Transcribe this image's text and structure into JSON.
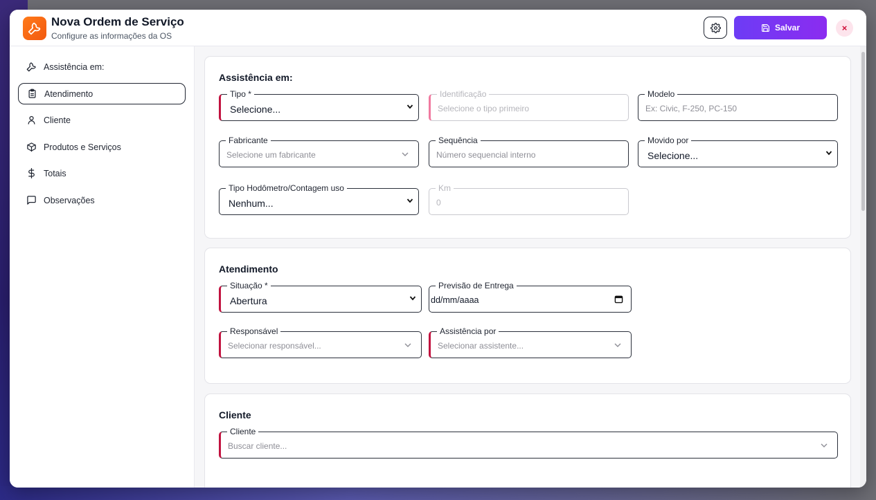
{
  "header": {
    "title": "Nova Ordem de Serviço",
    "subtitle": "Configure as informações da OS",
    "save_label": "Salvar",
    "close_label": "×",
    "accent": "#7c3aed",
    "logo_color": "#f97316"
  },
  "sidebar": {
    "items": [
      {
        "label": "Assistência em:",
        "icon": "wrench-icon"
      },
      {
        "label": "Atendimento",
        "icon": "clipboard-icon"
      },
      {
        "label": "Cliente",
        "icon": "user-icon"
      },
      {
        "label": "Produtos e Serviços",
        "icon": "box-icon"
      },
      {
        "label": "Totais",
        "icon": "dollar-icon"
      },
      {
        "label": "Observações",
        "icon": "comment-icon"
      }
    ]
  },
  "assistencia": {
    "title": "Assistência em:",
    "tipo": {
      "label": "Tipo *",
      "value": "Selecione..."
    },
    "identificacao": {
      "label": "Identificação",
      "placeholder": "Selecione o tipo primeiro"
    },
    "modelo": {
      "label": "Modelo",
      "placeholder": "Ex: Civic, F-250, PC-150"
    },
    "fabricante": {
      "label": "Fabricante",
      "placeholder": "Selecione um fabricante"
    },
    "sequencia": {
      "label": "Sequência",
      "placeholder": "Número sequencial interno"
    },
    "movido_por": {
      "label": "Movido por",
      "value": "Selecione..."
    },
    "tipo_hodometro": {
      "label": "Tipo Hodômetro/Contagem uso",
      "value": "Nenhum..."
    },
    "km": {
      "label": "Km",
      "placeholder": "0"
    }
  },
  "atendimento": {
    "title": "Atendimento",
    "situacao": {
      "label": "Situação *",
      "value": "Abertura"
    },
    "previsao": {
      "label": "Previsão de Entrega",
      "value": "dd/mm/aaaa"
    },
    "responsavel": {
      "label": "Responsável",
      "placeholder": "Selecionar responsável..."
    },
    "assistencia_por": {
      "label": "Assistência por",
      "placeholder": "Selecionar assistente..."
    }
  },
  "cliente": {
    "title": "Cliente",
    "cliente": {
      "label": "Cliente",
      "placeholder": "Buscar cliente..."
    }
  }
}
